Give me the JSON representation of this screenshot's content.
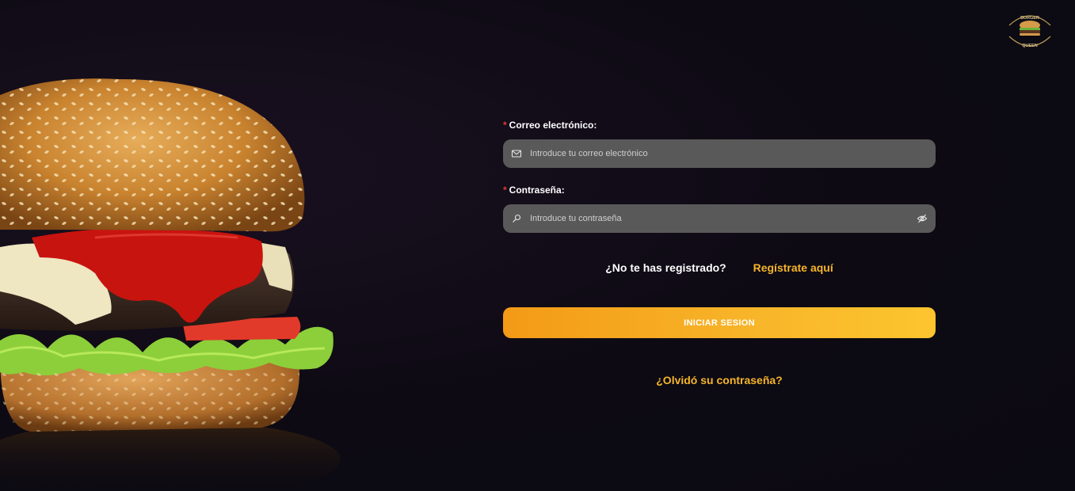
{
  "logo": {
    "top_text": "BURGER",
    "bottom_text": "QUEEN"
  },
  "form": {
    "email": {
      "required_mark": "*",
      "label": "Correo electrónico:",
      "placeholder": "Introduce tu correo electrónico",
      "value": ""
    },
    "password": {
      "required_mark": "*",
      "label": "Contraseña:",
      "placeholder": "Introduce tu contraseña",
      "value": ""
    },
    "register_question": "¿No te has registrado?",
    "register_link": "Regístrate aquí",
    "submit_label": "INICIAR SESION",
    "forgot_link": "¿Olvidó su contraseña?"
  },
  "icons": {
    "email_field": "mail-icon",
    "password_field": "key-icon",
    "password_toggle": "eye-off-icon"
  },
  "colors": {
    "background": "#0c0912",
    "input_bg": "#595959",
    "accent": "#f7b52a",
    "button_start": "#f39a17",
    "button_end": "#fcc52e",
    "required": "#e53935"
  }
}
